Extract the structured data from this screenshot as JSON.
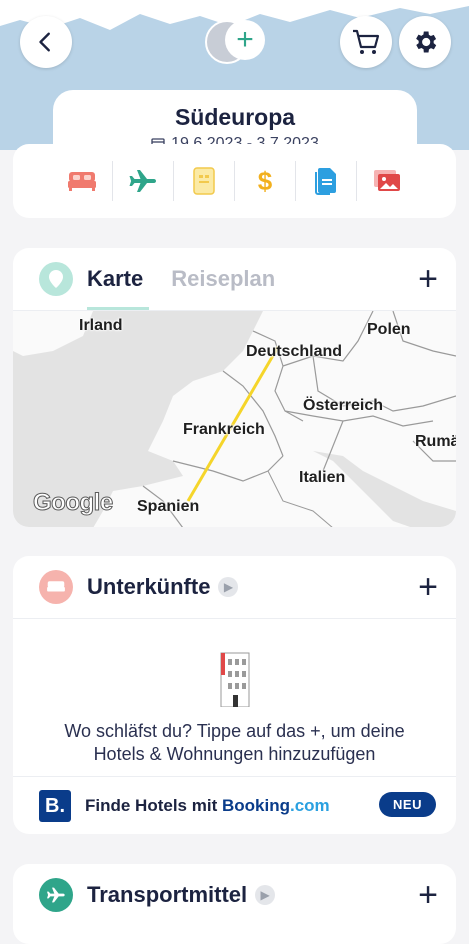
{
  "header": {
    "trip_title": "Südeuropa",
    "date_range": "19.6.2023 - 3.7.2023",
    "add_member_symbol": "+"
  },
  "categories": [
    {
      "name": "bed-icon",
      "color": "#f07a6e"
    },
    {
      "name": "plane-icon",
      "color": "#2fa58a"
    },
    {
      "name": "ticket-icon",
      "color": "#f2c94c"
    },
    {
      "name": "dollar-icon",
      "color": "#f2b01e",
      "glyph": "$"
    },
    {
      "name": "document-icon",
      "color": "#2d9fe0"
    },
    {
      "name": "photo-icon",
      "color": "#e04848"
    }
  ],
  "map_section": {
    "tab_active": "Karte",
    "tab_inactive": "Reiseplan",
    "add_symbol": "+",
    "labels": {
      "irland": "Irland",
      "deutschland": "Deutschland",
      "polen": "Polen",
      "oesterreich": "Österreich",
      "frankreich": "Frankreich",
      "rumaenien": "Rumä",
      "italien": "Italien",
      "spanien": "Spanien"
    },
    "attribution": "Google"
  },
  "accommodation": {
    "title": "Unterkünfte",
    "add_symbol": "+",
    "empty_line1": "Wo schläfst du? Tippe auf das +, um deine",
    "empty_line2": "Hotels & Wohnungen hinzuzufügen",
    "booking_prefix": "Finde Hotels mit ",
    "booking_brand_main": "Booking",
    "booking_brand_suffix": ".com",
    "booking_logo": "B.",
    "badge": "NEU"
  },
  "transport": {
    "title": "Transportmittel",
    "add_symbol": "+"
  },
  "colors": {
    "accent_green": "#2fa58a",
    "booking_blue": "#0a3c8a",
    "route_yellow": "#f5d52a"
  }
}
